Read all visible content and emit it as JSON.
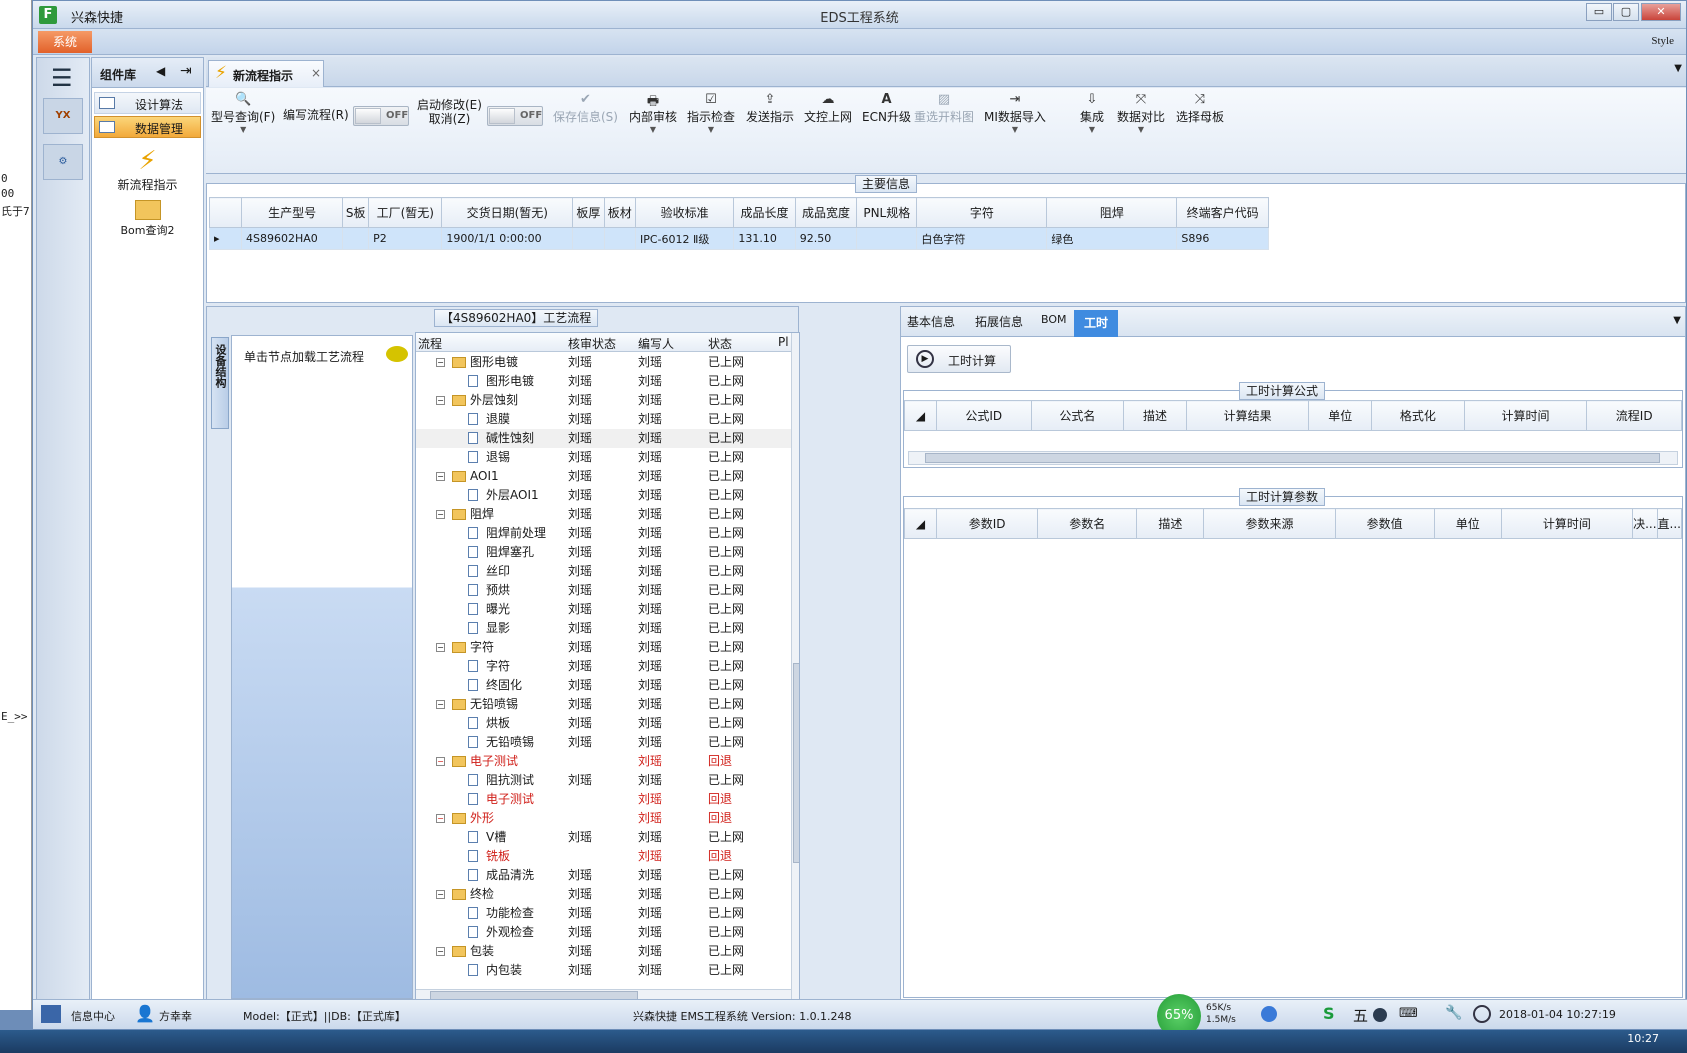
{
  "window": {
    "app_name": "兴森快捷",
    "title": "EDS工程系统",
    "controls": [
      "▭",
      "▢",
      "✕"
    ]
  },
  "menubar": {
    "system": "系统",
    "style": "Style"
  },
  "left_strip": [
    "0",
    "00",
    "氏于7",
    "E_>>"
  ],
  "nav": {
    "menu_icon": "☰",
    "icons": [
      "YX",
      "⚙"
    ]
  },
  "component_library": {
    "title": "组件库",
    "items": [
      {
        "label": "设计算法",
        "active": false
      },
      {
        "label": "数据管理",
        "active": true
      }
    ],
    "shortcuts": [
      {
        "label": "新流程指示",
        "icon": "lightning-icon"
      },
      {
        "label": "Bom查询2",
        "icon": "folder-icon"
      }
    ]
  },
  "tab": {
    "label": "新流程指示",
    "close": "×"
  },
  "toolbar": {
    "buttons": [
      {
        "label": "型号查询(F)",
        "icon": "🔍",
        "dropdown": true,
        "enabled": true
      },
      {
        "label": "编写流程(R)",
        "toggle": "OFF"
      },
      {
        "label": "启动修改(E)",
        "label2": "取消(Z)",
        "toggle": "OFF"
      },
      {
        "label": "保存信息(S)",
        "icon": "✔",
        "enabled": false
      },
      {
        "label": "内部审核",
        "icon": "🖶",
        "dropdown": true,
        "enabled": true
      },
      {
        "label": "指示检查",
        "icon": "☑",
        "dropdown": true,
        "enabled": true
      },
      {
        "label": "发送指示",
        "icon": "⇪",
        "enabled": true
      },
      {
        "label": "文控上网",
        "icon": "☁",
        "enabled": true
      },
      {
        "label": "ECN升级",
        "icon": "A",
        "enabled": true
      },
      {
        "label": "重选开料图",
        "icon": "▨",
        "enabled": false
      },
      {
        "label": "MI数据导入",
        "icon": "⇥",
        "dropdown": true,
        "enabled": true
      },
      {
        "label": "集成",
        "icon": "⇩",
        "dropdown": true,
        "enabled": true
      },
      {
        "label": "数据对比",
        "icon": "⤧",
        "dropdown": true,
        "enabled": true
      },
      {
        "label": "选择母板",
        "icon": "⤨",
        "enabled": true
      }
    ]
  },
  "main_info": {
    "title": "主要信息",
    "columns": [
      "生产型号",
      "S板",
      "工厂(暂无)",
      "交货日期(暂无)",
      "板厚",
      "板材",
      "验收标准",
      "成品长度",
      "成品宽度",
      "PNL规格",
      "字符",
      "阻焊",
      "终端客户代码"
    ],
    "rows": [
      [
        "4S89602HA0",
        "",
        "P2",
        "1900/1/1 0:00:00",
        "",
        "",
        "IPC-6012 Ⅱ级",
        "131.10",
        "92.50",
        "",
        "白色字符",
        "绿色",
        "S896"
      ]
    ]
  },
  "process": {
    "title": "【4S89602HA0】工艺流程",
    "device_tab": "设备结构",
    "device_hint": "单击节点加载工艺流程",
    "columns": [
      "流程",
      "核审状态",
      "编写人",
      "状态",
      "Pl"
    ],
    "rows": [
      {
        "name": "图形电镀",
        "level": 0,
        "audit": "刘瑶",
        "author": "刘瑶",
        "status": "已上网",
        "red": false
      },
      {
        "name": "图形电镀",
        "level": 1,
        "audit": "刘瑶",
        "author": "刘瑶",
        "status": "已上网",
        "red": false
      },
      {
        "name": "外层蚀刻",
        "level": 0,
        "audit": "刘瑶",
        "author": "刘瑶",
        "status": "已上网",
        "red": false
      },
      {
        "name": "退膜",
        "level": 1,
        "audit": "刘瑶",
        "author": "刘瑶",
        "status": "已上网",
        "red": false
      },
      {
        "name": "碱性蚀刻",
        "level": 1,
        "audit": "刘瑶",
        "author": "刘瑶",
        "status": "已上网",
        "red": false
      },
      {
        "name": "退锡",
        "level": 1,
        "audit": "刘瑶",
        "author": "刘瑶",
        "status": "已上网",
        "red": false
      },
      {
        "name": "AOI1",
        "level": 0,
        "audit": "刘瑶",
        "author": "刘瑶",
        "status": "已上网",
        "red": false
      },
      {
        "name": "外层AOI1",
        "level": 1,
        "audit": "刘瑶",
        "author": "刘瑶",
        "status": "已上网",
        "red": false
      },
      {
        "name": "阻焊",
        "level": 0,
        "audit": "刘瑶",
        "author": "刘瑶",
        "status": "已上网",
        "red": false
      },
      {
        "name": "阻焊前处理",
        "level": 1,
        "audit": "刘瑶",
        "author": "刘瑶",
        "status": "已上网",
        "red": false
      },
      {
        "name": "阻焊塞孔",
        "level": 1,
        "audit": "刘瑶",
        "author": "刘瑶",
        "status": "已上网",
        "red": false
      },
      {
        "name": "丝印",
        "level": 1,
        "audit": "刘瑶",
        "author": "刘瑶",
        "status": "已上网",
        "red": false
      },
      {
        "name": "预烘",
        "level": 1,
        "audit": "刘瑶",
        "author": "刘瑶",
        "status": "已上网",
        "red": false
      },
      {
        "name": "曝光",
        "level": 1,
        "audit": "刘瑶",
        "author": "刘瑶",
        "status": "已上网",
        "red": false
      },
      {
        "name": "显影",
        "level": 1,
        "audit": "刘瑶",
        "author": "刘瑶",
        "status": "已上网",
        "red": false
      },
      {
        "name": "字符",
        "level": 0,
        "audit": "刘瑶",
        "author": "刘瑶",
        "status": "已上网",
        "red": false
      },
      {
        "name": "字符",
        "level": 1,
        "audit": "刘瑶",
        "author": "刘瑶",
        "status": "已上网",
        "red": false
      },
      {
        "name": "终固化",
        "level": 1,
        "audit": "刘瑶",
        "author": "刘瑶",
        "status": "已上网",
        "red": false
      },
      {
        "name": "无铅喷锡",
        "level": 0,
        "audit": "刘瑶",
        "author": "刘瑶",
        "status": "已上网",
        "red": false
      },
      {
        "name": "烘板",
        "level": 1,
        "audit": "刘瑶",
        "author": "刘瑶",
        "status": "已上网",
        "red": false
      },
      {
        "name": "无铅喷锡",
        "level": 1,
        "audit": "刘瑶",
        "author": "刘瑶",
        "status": "已上网",
        "red": false
      },
      {
        "name": "电子测试",
        "level": 0,
        "audit": "",
        "author": "刘瑶",
        "status": "回退",
        "red": true
      },
      {
        "name": "阻抗测试",
        "level": 1,
        "audit": "刘瑶",
        "author": "刘瑶",
        "status": "已上网",
        "red": false
      },
      {
        "name": "电子测试",
        "level": 1,
        "audit": "",
        "author": "刘瑶",
        "status": "回退",
        "red": true
      },
      {
        "name": "外形",
        "level": 0,
        "audit": "",
        "author": "刘瑶",
        "status": "回退",
        "red": true
      },
      {
        "name": "V槽",
        "level": 1,
        "audit": "刘瑶",
        "author": "刘瑶",
        "status": "已上网",
        "red": false
      },
      {
        "name": "铣板",
        "level": 1,
        "audit": "",
        "author": "刘瑶",
        "status": "回退",
        "red": true
      },
      {
        "name": "成品清洗",
        "level": 1,
        "audit": "刘瑶",
        "author": "刘瑶",
        "status": "已上网",
        "red": false
      },
      {
        "name": "终检",
        "level": 0,
        "audit": "刘瑶",
        "author": "刘瑶",
        "status": "已上网",
        "red": false
      },
      {
        "name": "功能检查",
        "level": 1,
        "audit": "刘瑶",
        "author": "刘瑶",
        "status": "已上网",
        "red": false
      },
      {
        "name": "外观检查",
        "level": 1,
        "audit": "刘瑶",
        "author": "刘瑶",
        "status": "已上网",
        "red": false
      },
      {
        "name": "包装",
        "level": 0,
        "audit": "刘瑶",
        "author": "刘瑶",
        "status": "已上网",
        "red": false
      },
      {
        "name": "内包装",
        "level": 1,
        "audit": "刘瑶",
        "author": "刘瑶",
        "status": "已上网",
        "red": false
      }
    ]
  },
  "right_panel": {
    "tabs": [
      "基本信息",
      "拓展信息",
      "BOM",
      "工时"
    ],
    "active_tab": "工时",
    "calc_button": "工时计算",
    "formula": {
      "title": "工时计算公式",
      "columns": [
        "公式ID",
        "公式名",
        "描述",
        "计算结果",
        "单位",
        "格式化",
        "计算时间",
        "流程ID"
      ]
    },
    "params": {
      "title": "工时计算参数",
      "columns": [
        "参数ID",
        "参数名",
        "描述",
        "参数来源",
        "参数值",
        "单位",
        "计算时间",
        "决...",
        "直..."
      ]
    }
  },
  "statusbar": {
    "info_center": "信息中心",
    "user": "方幸幸",
    "model": "Model:【正式】||DB:【正式库】",
    "app_version": "兴森快捷 EMS工程系统 Version: 1.0.1.248",
    "cpu": "65%",
    "upload": "65K/s",
    "download": "1.5M/s",
    "ime": "五",
    "datetime": "2018-01-04 10:27:19"
  },
  "taskbar": {
    "clock": "10:27"
  }
}
